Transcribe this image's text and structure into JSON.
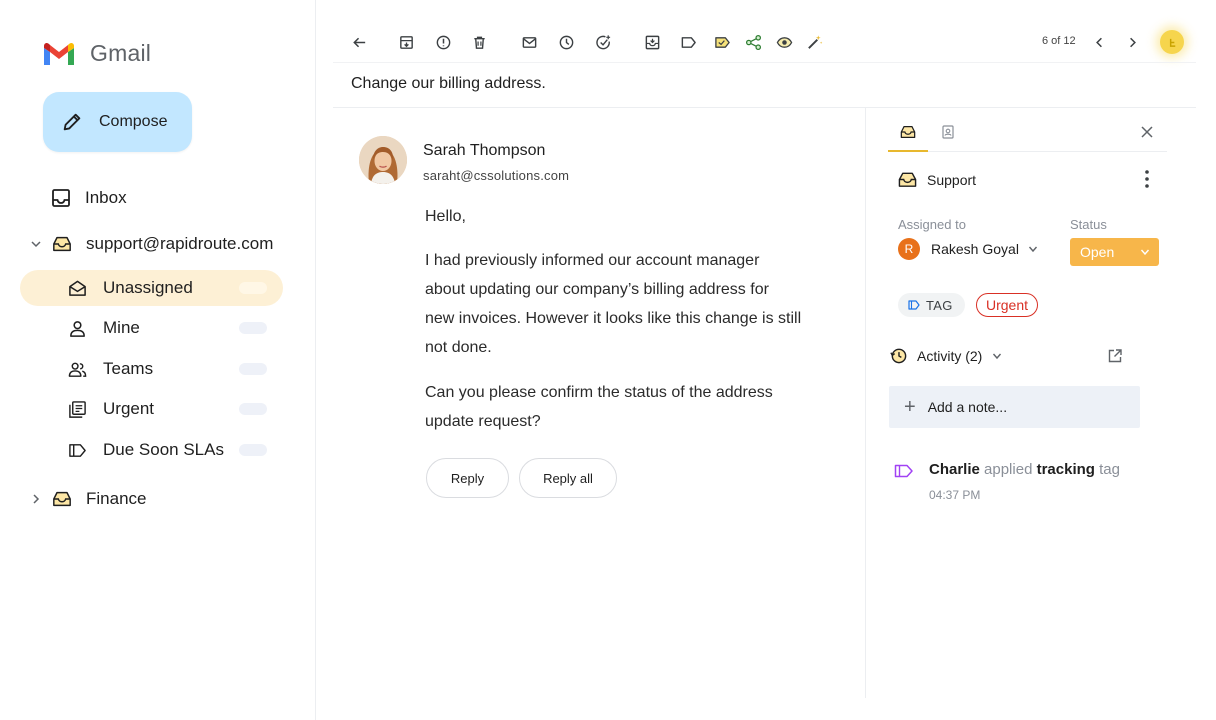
{
  "app": {
    "name": "Gmail"
  },
  "sidebar": {
    "compose_label": "Compose",
    "inbox_label": "Inbox",
    "account": "support@rapidroute.com",
    "sub_items": [
      {
        "label": "Unassigned",
        "icon": "open-envelope-icon",
        "active": true
      },
      {
        "label": "Mine",
        "icon": "person-icon",
        "active": false
      },
      {
        "label": "Teams",
        "icon": "people-icon",
        "active": false
      },
      {
        "label": "Urgent",
        "icon": "stacked-docs-icon",
        "active": false
      },
      {
        "label": "Due Soon SLAs",
        "icon": "label-icon",
        "active": false
      }
    ],
    "finance_label": "Finance"
  },
  "toolbar": {
    "pager": "6 of 12",
    "icons": [
      "back-arrow-icon",
      "archive-icon",
      "report-spam-icon",
      "delete-icon",
      "mark-unread-icon",
      "snooze-icon",
      "add-task-icon",
      "move-to-icon",
      "label-icon",
      "tag-icon",
      "share-icon",
      "eye-icon",
      "magic-wand-icon"
    ],
    "accent": "#f6d54d"
  },
  "email": {
    "subject": "Change our billing address.",
    "sender_name": "Sarah Thompson",
    "sender_email": "saraht@cssolutions.com",
    "greeting": "Hello,",
    "paragraph1_lines": [
      "I had previously informed our account manager",
      "about updating our company’s billing address for",
      "new invoices. However it looks like this change is still",
      "not done."
    ],
    "paragraph2_lines": [
      "Can you please confirm the status of the address",
      "update request?"
    ],
    "reply_label": "Reply",
    "reply_all_label": "Reply all"
  },
  "panel": {
    "inbox_name": "Support",
    "assigned_to_label": "Assigned to",
    "assignee_initial": "R",
    "assignee_name": "Rakesh Goyal",
    "status_label": "Status",
    "status_value": "Open",
    "status_color": "#f7b64a",
    "tag_label": "TAG",
    "urgent_label": "Urgent",
    "urgent_color": "#d93025",
    "activity_label": "Activity (2)",
    "add_note_label": "Add a note...",
    "log": {
      "actor": "Charlie",
      "action": "applied",
      "tag": "tracking",
      "suffix": "tag",
      "time": "04:37 PM"
    }
  }
}
